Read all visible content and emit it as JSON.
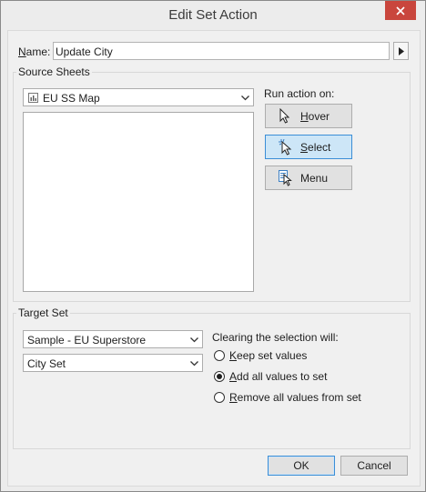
{
  "window": {
    "title": "Edit Set Action"
  },
  "name": {
    "label": "Name:",
    "value": "Update City"
  },
  "source_sheets": {
    "legend": "Source Sheets",
    "sheet_dropdown": "EU SS Map",
    "run_action_label": "Run action on:",
    "buttons": [
      {
        "label": "Hover",
        "icon": "pointer-icon",
        "selected": false
      },
      {
        "label": "Select",
        "icon": "select-pointer-icon",
        "selected": true
      },
      {
        "label": "Menu",
        "icon": "menu-pointer-icon",
        "selected": false
      }
    ]
  },
  "target_set": {
    "legend": "Target Set",
    "datasource_dropdown": "Sample - EU Superstore",
    "set_dropdown": "City Set",
    "clearing_label": "Clearing the selection will:",
    "options": [
      {
        "label": "Keep set values",
        "checked": false
      },
      {
        "label": "Add all values to set",
        "checked": true
      },
      {
        "label": "Remove all values from set",
        "checked": false
      }
    ]
  },
  "footer": {
    "ok_label": "OK",
    "cancel_label": "Cancel"
  },
  "colors": {
    "close": "#c9463d",
    "accent": "#3b8ed6",
    "selected_bg": "#cde6f7"
  }
}
